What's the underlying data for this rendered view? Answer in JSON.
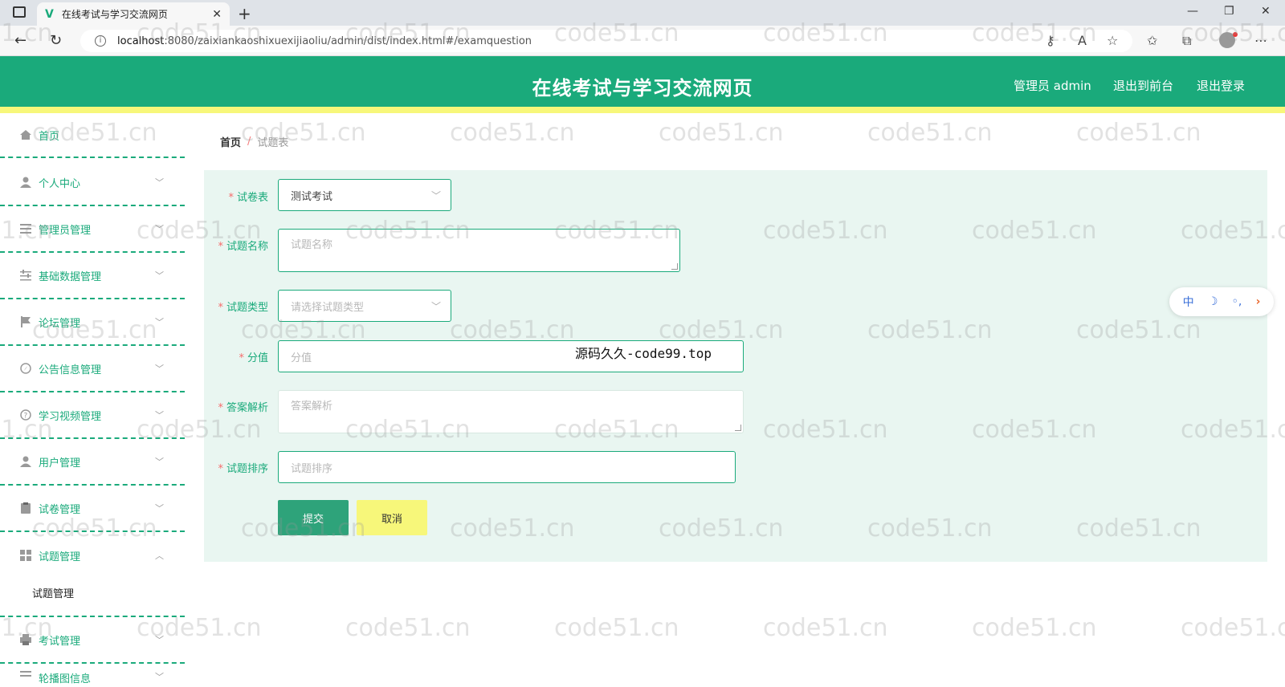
{
  "browser": {
    "tab_title": "在线考试与学习交流网页",
    "url_host": "localhost",
    "url_path": ":8080/zaixiankaoshixuexijiaoliu/admin/dist/index.html#/examquestion"
  },
  "header": {
    "title": "在线考试与学习交流网页",
    "admin_label": "管理员 admin",
    "to_front": "退出到前台",
    "logout": "退出登录"
  },
  "sidebar": {
    "items": [
      {
        "label": "首页",
        "icon": "home-icon"
      },
      {
        "label": "个人中心",
        "icon": "user-icon"
      },
      {
        "label": "管理员管理",
        "icon": "list-icon"
      },
      {
        "label": "基础数据管理",
        "icon": "sliders-icon"
      },
      {
        "label": "论坛管理",
        "icon": "flag-icon"
      },
      {
        "label": "公告信息管理",
        "icon": "compass-icon"
      },
      {
        "label": "学习视频管理",
        "icon": "help-icon"
      },
      {
        "label": "用户管理",
        "icon": "user-icon"
      },
      {
        "label": "试卷管理",
        "icon": "clipboard-icon"
      },
      {
        "label": "试题管理",
        "icon": "grid-icon"
      },
      {
        "label": "考试管理",
        "icon": "printer-icon"
      },
      {
        "label": "轮播图信息",
        "icon": "list-icon"
      }
    ],
    "active_sub": "试题管理"
  },
  "breadcrumb": {
    "home": "首页",
    "separator": "/",
    "current": "试题表"
  },
  "form": {
    "paper": {
      "label": "试卷表",
      "value": "测试考试"
    },
    "name": {
      "label": "试题名称",
      "placeholder": "试题名称"
    },
    "type": {
      "label": "试题类型",
      "placeholder": "请选择试题类型"
    },
    "score": {
      "label": "分值",
      "placeholder": "分值"
    },
    "analysis": {
      "label": "答案解析",
      "placeholder": "答案解析"
    },
    "sort": {
      "label": "试题排序",
      "placeholder": "试题排序"
    },
    "required_mark": "*",
    "submit": "提交",
    "cancel": "取消"
  },
  "overlay_text": "源码久久-code99.top",
  "widget": {
    "lang": "中",
    "moon": "☽",
    "dots": "◦,",
    "next": "›"
  },
  "watermark": "code51.cn",
  "colors": {
    "primary": "#1aaa7b",
    "yellow": "#f7f77a",
    "panel": "#e9f6f1"
  }
}
